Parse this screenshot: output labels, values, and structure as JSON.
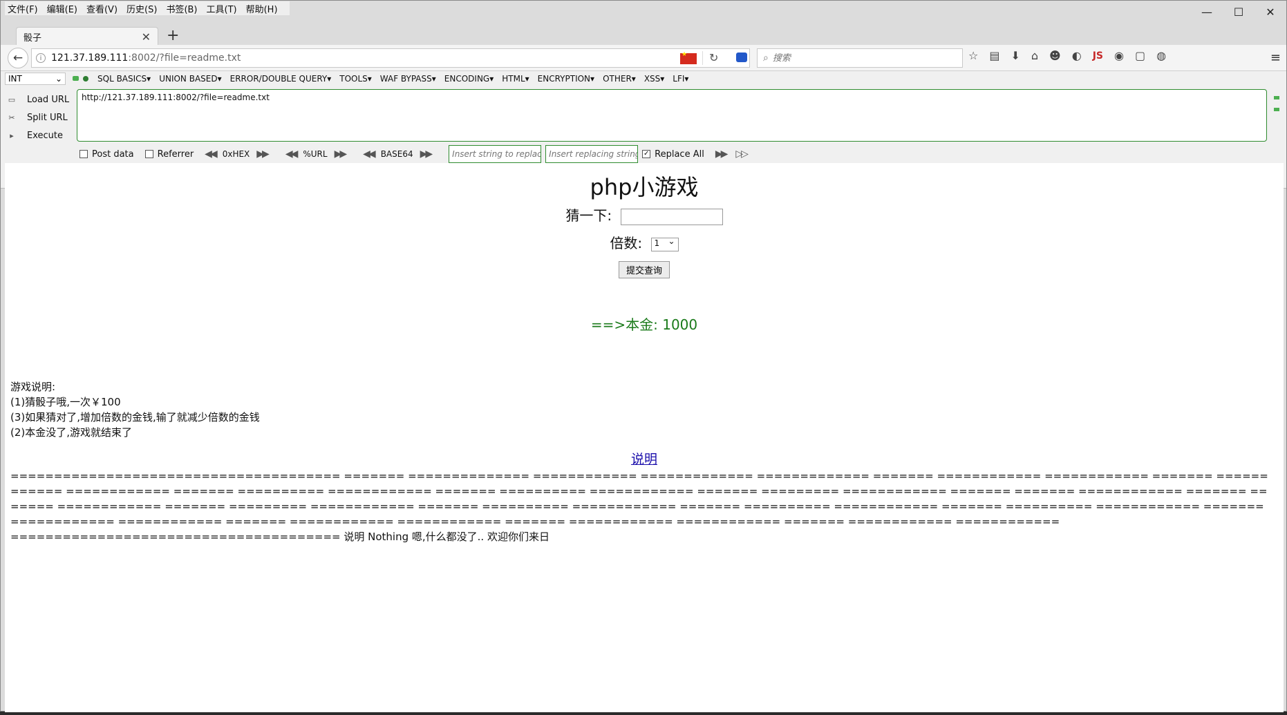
{
  "menubar": [
    "文件(F)",
    "编辑(E)",
    "查看(V)",
    "历史(S)",
    "书签(B)",
    "工具(T)",
    "帮助(H)"
  ],
  "window_controls": {
    "minimize": "—",
    "maximize": "☐",
    "close": "✕"
  },
  "tab": {
    "title": "骰子",
    "close": "✕",
    "new_tab": "+"
  },
  "url": {
    "host": "121.37.189.111",
    "rest": ":8002/?file=readme.txt"
  },
  "search": {
    "placeholder": "搜索"
  },
  "hackbar": {
    "select_value": "INT",
    "menu": [
      "SQL BASICS▾",
      "UNION BASED▾",
      "ERROR/DOUBLE QUERY▾",
      "TOOLS▾",
      "WAF BYPASS▾",
      "ENCODING▾",
      "HTML▾",
      "ENCRYPTION▾",
      "OTHER▾",
      "XSS▾",
      "LFI▾"
    ],
    "load_url": "Load URL",
    "split_url": "Split URL",
    "execute": "Execute",
    "textarea": "http://121.37.189.111:8002/?file=readme.txt",
    "post_data": "Post data",
    "referrer": "Referrer",
    "hex": "0xHEX",
    "urlenc": "%URL",
    "base64": "BASE64",
    "replace_placeholder": "Insert string to replace",
    "replacing_placeholder": "Insert replacing string",
    "replace_all": "Replace All"
  },
  "page": {
    "title": "php小游戏",
    "guess_label": "猜一下:",
    "multiplier_label": "倍数:",
    "multiplier_value": "1",
    "submit": "提交查询",
    "balance": "==>本金: 1000",
    "rules": [
      "游戏说明:",
      "(1)猜骰子哦,一次￥100",
      "(3)如果猜对了,增加倍数的金钱,输了就减少倍数的金钱",
      "(2)本金没了,游戏就结束了"
    ],
    "explain_link": "说明",
    "equals_text": "====================================== ======= ============== ============ ============= ============= ======= ============ ============ ======= ============ ============ ======= ========== ============ ======= ========== ============ ======= ========= ============ ======= ======= ============ ======= ======= ============ ======= ========= ============ ======= ========== ============ ======= ========== ============ ======= ========== ============ ======= ============ ============ ======= ============ ============ ======= ============ ============ ======= ============ ============",
    "tail_text": "====================================== 说明 Nothing 嗯,什么都没了.. 欢迎你们来日"
  }
}
